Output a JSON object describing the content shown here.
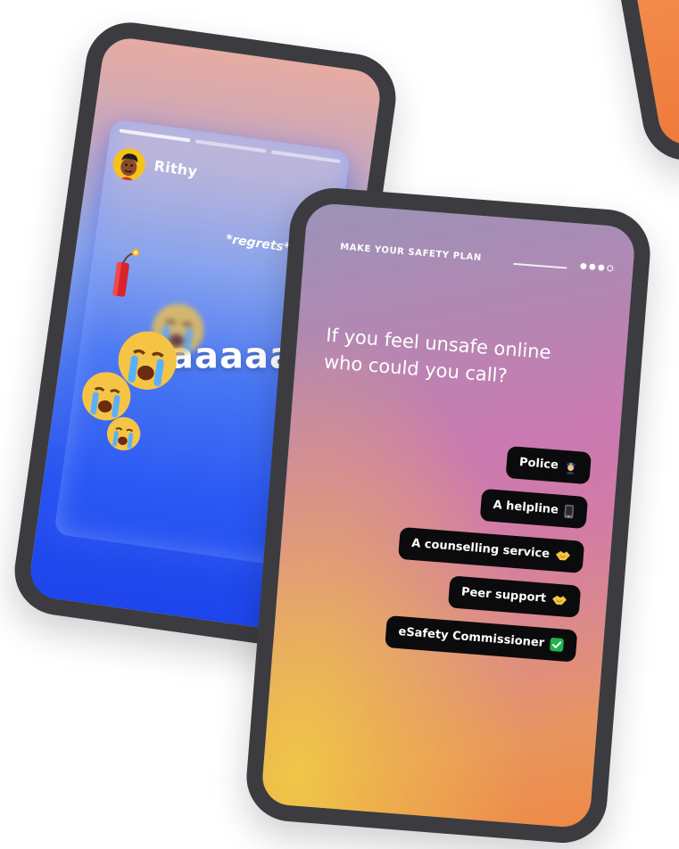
{
  "story": {
    "username": "Rithy",
    "caption": "*regrets*",
    "scream": "aaaaah"
  },
  "plan": {
    "header": "MAKE YOUR SAFETY PLAN",
    "progress": {
      "filled": 3,
      "total": 4
    },
    "question_line1": "If you feel unsafe online",
    "question_line2": "who could you call?",
    "options": [
      {
        "label": "Police",
        "icon": "police-officer-icon"
      },
      {
        "label": "A helpline",
        "icon": "mobile-phone-icon"
      },
      {
        "label": "A counselling service",
        "icon": "handshake-icon"
      },
      {
        "label": "Peer support",
        "icon": "handshake-icon"
      },
      {
        "label": "eSafety Commissioner",
        "icon": "check-mark-icon"
      }
    ]
  },
  "colors": {
    "phone_frame": "#3c3c40",
    "chip_bg": "#0b0b0d",
    "avatar_bg": "#f5c21b",
    "check_green": "#22b14c"
  }
}
